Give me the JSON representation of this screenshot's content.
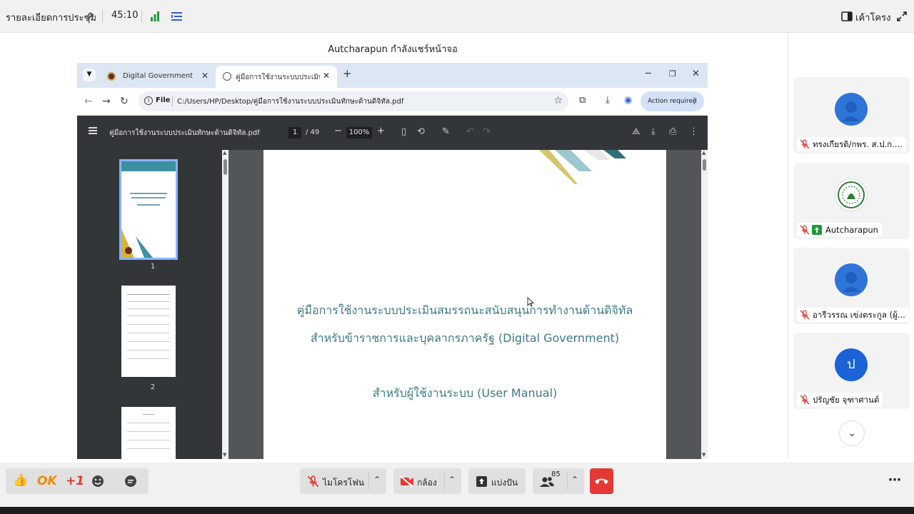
{
  "meeting": {
    "details_label": "รายละเอียดการประชุม",
    "elapsed": "45:10",
    "layout_label": "เค้าโครง",
    "presenter_caption": "Autcharapun กำลังแชร์หน้าจอ"
  },
  "browser": {
    "tabs": [
      {
        "label": "Digital Government",
        "active": false
      },
      {
        "label": "คู่มือการใช้งานระบบประเมินทักษะด้าน",
        "active": true
      }
    ],
    "file_label": "File",
    "url": "C:/Users/HP/Desktop/คู่มือการใช้งานระบบประเมินทักษะด้านดิจิทัล.pdf",
    "action_required_label": "Action required"
  },
  "pdf": {
    "filename": "คู่มือการใช้งานระบบประเมินทักษะด้านดิจิทัล.pdf",
    "current_page": "1",
    "total_pages": "/ 49",
    "zoom": "100%",
    "thumbnails": [
      {
        "number": "1",
        "selected": true
      },
      {
        "number": "2",
        "selected": false
      },
      {
        "number": "",
        "selected": false
      }
    ],
    "page_title_line1": "คู่มือการใช้งานระบบประเมินสมรรถนะสนับสนุนการทำงานด้านดิจิทัล",
    "page_title_line2": "สำหรับข้าราชการและบุคลากรภาครัฐ (Digital Government)",
    "page_subtitle": "สำหรับผู้ใช้งานระบบ (User Manual)"
  },
  "participants": [
    {
      "name": "ทรงเกียรติ/กพร. ส.ป.ก....",
      "avatar": "person",
      "muted": true
    },
    {
      "name": "Autcharapun",
      "avatar": "seal",
      "muted": true,
      "presenting": true
    },
    {
      "name": "อารีวรรณ เข่งตระกูล (ผู้...",
      "avatar": "person",
      "muted": true
    },
    {
      "name": "ปรัญชัย จุฑาศานต์",
      "avatar": "initial",
      "initial": "ป",
      "muted": true
    }
  ],
  "reactions": {
    "ok_label": "OK",
    "plus_one_label": "+1"
  },
  "controls": {
    "mic_label": "ไมโครโฟน",
    "camera_label": "กล้อง",
    "share_label": "แบ่งปัน",
    "participant_count": "85"
  },
  "colors": {
    "accent_blue": "#2f74d8",
    "end_call_red": "#e53935",
    "signal_green": "#1e9c3a",
    "pdf_title_teal": "#3c7a87"
  }
}
